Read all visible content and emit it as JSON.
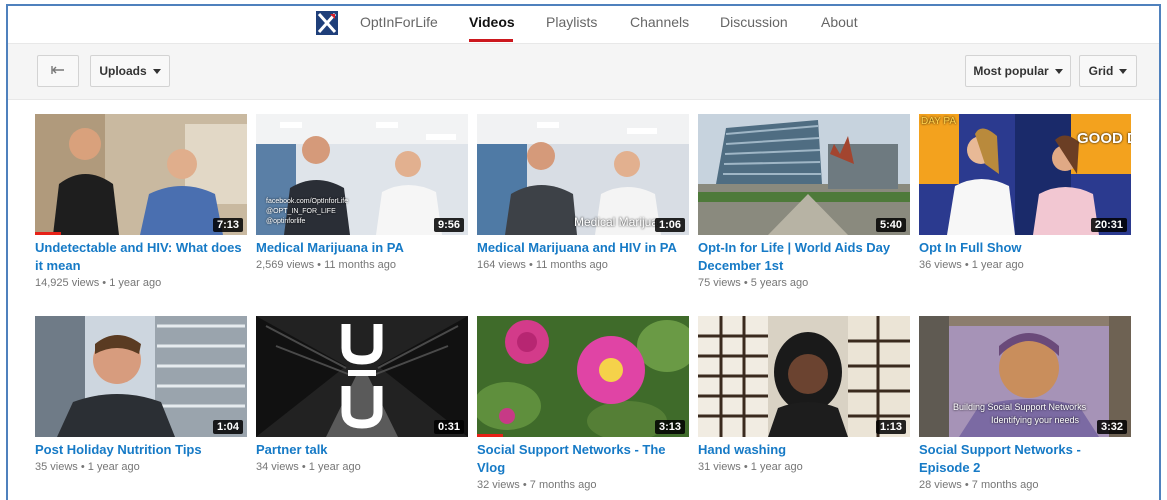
{
  "channel_nav": {
    "channel_name": "OptInForLife",
    "tabs": [
      "Videos",
      "Playlists",
      "Channels",
      "Discussion",
      "About"
    ],
    "active_tab": "Videos"
  },
  "toolbar": {
    "back_icon": "arrow-left-icon",
    "uploads_label": "Uploads",
    "sort_label": "Most popular",
    "view_label": "Grid"
  },
  "videos": [
    {
      "title": "Undetectable and HIV: What does it mean",
      "views": "14,925 views",
      "age": "1 year ago",
      "duration": "7:13",
      "watched_fraction": 0.12
    },
    {
      "title": "Medical Marijuana in PA",
      "views": "2,569 views",
      "age": "11 months ago",
      "duration": "9:56",
      "overlay": [
        "facebook.com/OptInforLife",
        "@OPT_IN_FOR_LIFE",
        "@optinforlife"
      ]
    },
    {
      "title": "Medical Marijuana and HIV in PA",
      "views": "164 views",
      "age": "11 months ago",
      "duration": "1:06",
      "overlay": [
        "Medical Marijua"
      ]
    },
    {
      "title": "Opt-In for Life | World Aids Day December 1st",
      "views": "75 views",
      "age": "5 years ago",
      "duration": "5:40"
    },
    {
      "title": "Opt In Full Show",
      "views": "36 views",
      "age": "1 year ago",
      "duration": "20:31",
      "overlay": [
        "GOOD DAY",
        "DAY PA"
      ]
    },
    {
      "title": "Post Holiday Nutrition Tips",
      "views": "35 views",
      "age": "1 year ago",
      "duration": "1:04"
    },
    {
      "title": "Partner talk",
      "views": "34 views",
      "age": "1 year ago",
      "duration": "0:31"
    },
    {
      "title": "Social Support Networks - The Vlog",
      "views": "32 views",
      "age": "7 months ago",
      "duration": "3:13",
      "watched_fraction": 0.12
    },
    {
      "title": "Hand washing",
      "views": "31 views",
      "age": "1 year ago",
      "duration": "1:13"
    },
    {
      "title": "Social Support Networks - Episode 2",
      "views": "28 views",
      "age": "7 months ago",
      "duration": "3:32",
      "overlay": [
        "Building Social Support Networks",
        "Identifying your needs"
      ]
    }
  ],
  "dot_separator": "•",
  "colors": {
    "title_link": "#167ac6",
    "active_underline": "#cc181e",
    "progress": "#e62117",
    "frame_border": "#4f81bd"
  }
}
